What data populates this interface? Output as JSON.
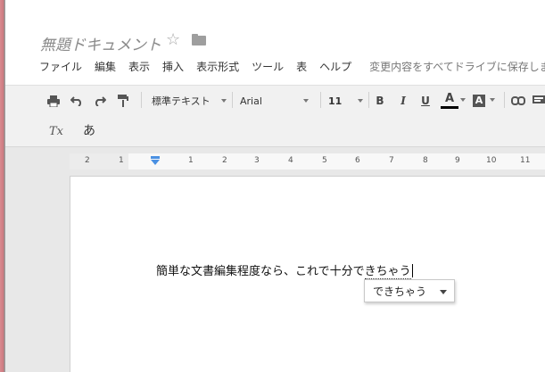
{
  "document": {
    "title": "無題ドキュメント"
  },
  "menu": {
    "items": [
      "ファイル",
      "編集",
      "表示",
      "挿入",
      "表示形式",
      "ツール",
      "表",
      "ヘルプ"
    ],
    "save_status": "変更内容をすべてドライブに保存しました"
  },
  "toolbar": {
    "style_label": "標準テキスト",
    "font_label": "Arial",
    "size_label": "11",
    "bold_label": "B",
    "italic_label": "I",
    "underline_label": "U",
    "text_color_label": "A",
    "highlight_label": "A",
    "clear_format_label": "Tx",
    "input_mode_label": "あ"
  },
  "ruler": {
    "labels": [
      "2",
      "1",
      "1",
      "2",
      "3",
      "4",
      "5",
      "6",
      "7",
      "8",
      "9",
      "10",
      "11"
    ]
  },
  "content": {
    "committed_text": "簡単な文書編集程度なら、これで十分で",
    "composing_text": "きちゃう"
  },
  "suggestion": {
    "candidate": "できちゃう"
  },
  "colors": {
    "text_color_bar": "#000000",
    "sidebar_strip": "#cc7a80",
    "toolbar_bg": "#f1f1f1"
  }
}
